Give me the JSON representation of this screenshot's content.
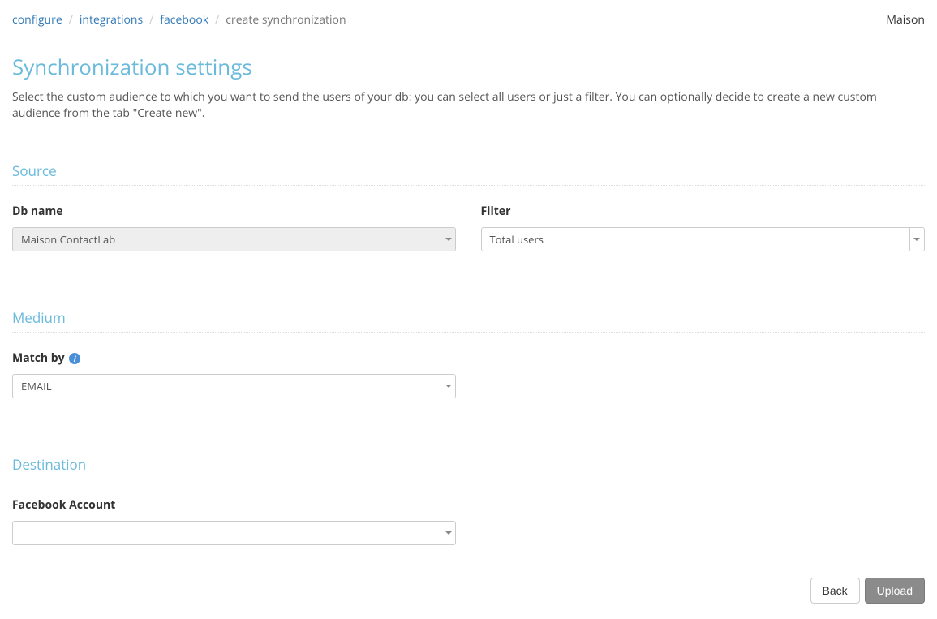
{
  "breadcrumb": {
    "configure": "configure",
    "integrations": "integrations",
    "facebook": "facebook",
    "create_sync": "create synchronization"
  },
  "account": "Maison",
  "page": {
    "title": "Synchronization settings",
    "description": "Select the custom audience to which you want to send the users of your db: you can select all users or just a filter. You can optionally decide to create a new custom audience from the tab \"Create new\"."
  },
  "sections": {
    "source": {
      "heading": "Source",
      "db_label": "Db name",
      "db_value": "Maison ContactLab",
      "filter_label": "Filter",
      "filter_value": "Total users"
    },
    "medium": {
      "heading": "Medium",
      "match_label": "Match by",
      "match_value": "EMAIL"
    },
    "destination": {
      "heading": "Destination",
      "fb_label": "Facebook Account",
      "fb_value": ""
    }
  },
  "buttons": {
    "back": "Back",
    "upload": "Upload"
  }
}
